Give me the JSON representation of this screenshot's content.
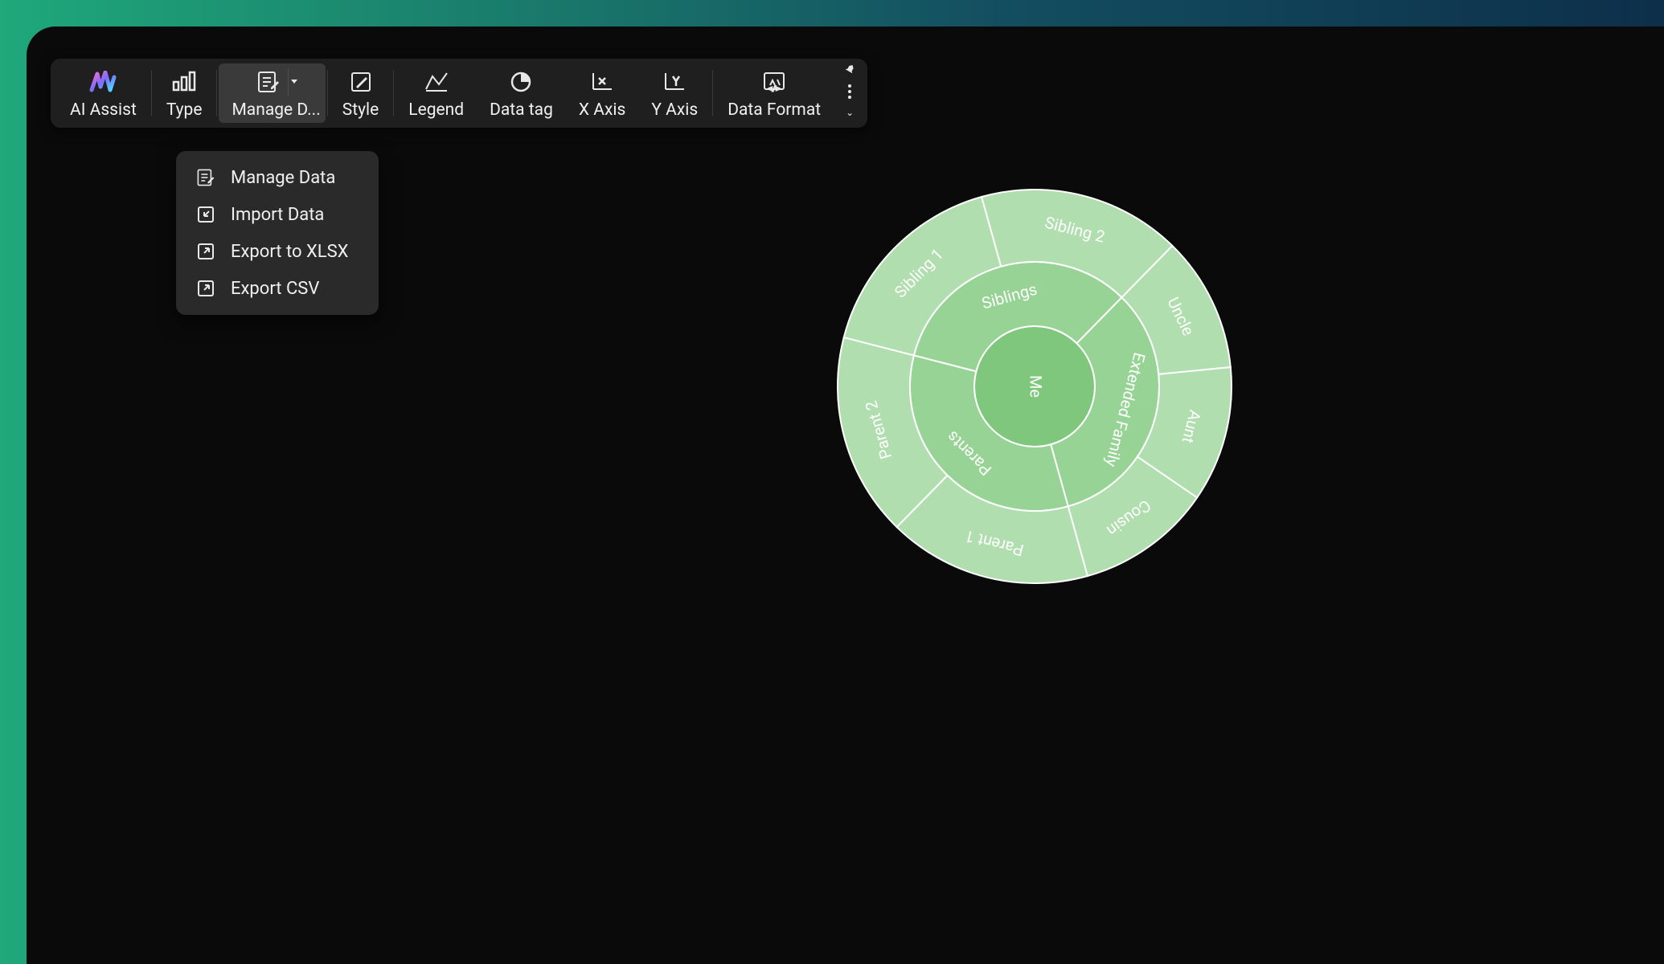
{
  "toolbar": {
    "items": [
      {
        "id": "ai-assist",
        "label": "AI Assist",
        "icon": "ai-assist-icon"
      },
      {
        "id": "type",
        "label": "Type",
        "icon": "bar-chart-icon"
      },
      {
        "id": "manage-data",
        "label": "Manage D...",
        "icon": "manage-data-icon",
        "active": true,
        "split": true
      },
      {
        "id": "style",
        "label": "Style",
        "icon": "style-icon"
      },
      {
        "id": "legend",
        "label": "Legend",
        "icon": "legend-icon"
      },
      {
        "id": "data-tag",
        "label": "Data tag",
        "icon": "data-tag-icon"
      },
      {
        "id": "x-axis",
        "label": "X Axis",
        "icon": "x-axis-icon"
      },
      {
        "id": "y-axis",
        "label": "Y Axis",
        "icon": "y-axis-icon"
      },
      {
        "id": "data-format",
        "label": "Data Format",
        "icon": "data-format-icon"
      }
    ],
    "pin_icon": "pin-icon",
    "more_icon": "more-icon"
  },
  "dropdown": {
    "items": [
      {
        "id": "manage-data",
        "label": "Manage Data",
        "icon": "manage-data-icon"
      },
      {
        "id": "import-data",
        "label": "Import Data",
        "icon": "import-icon"
      },
      {
        "id": "export-xlsx",
        "label": "Export to XLSX",
        "icon": "export-icon"
      },
      {
        "id": "export-csv",
        "label": "Export CSV",
        "icon": "export-icon"
      }
    ]
  },
  "chart_data": {
    "type": "sunburst",
    "root": {
      "name": "Me",
      "children": [
        {
          "name": "Siblings",
          "value": 1,
          "children": [
            {
              "name": "Sibling 1",
              "value": 1
            },
            {
              "name": "Sibling 2",
              "value": 1
            }
          ]
        },
        {
          "name": "Extended Family",
          "value": 1,
          "children": [
            {
              "name": "Uncle",
              "value": 1
            },
            {
              "name": "Aunt",
              "value": 1
            },
            {
              "name": "Cousin",
              "value": 1
            }
          ]
        },
        {
          "name": "Parents",
          "value": 1,
          "children": [
            {
              "name": "Parent 1",
              "value": 1
            },
            {
              "name": "Parent 2",
              "value": 1
            }
          ]
        }
      ]
    },
    "colors": {
      "root": "#7ec77c",
      "ring1": "#97d395",
      "ring2": "#b0deae",
      "stroke": "#ffffff"
    }
  }
}
